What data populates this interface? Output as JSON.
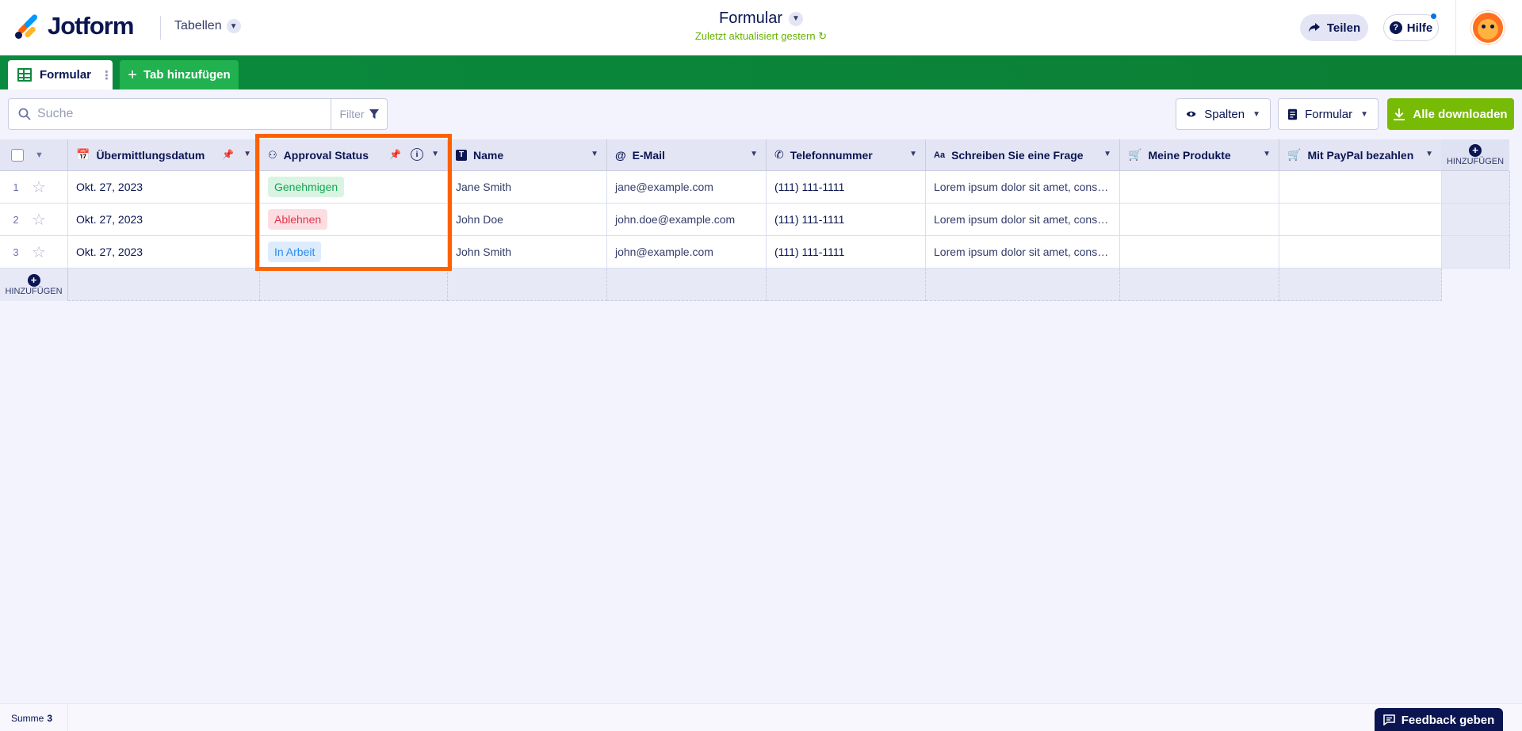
{
  "header": {
    "logo_text": "Jotform",
    "tables_menu": "Tabellen",
    "title": "Formular",
    "subtitle": "Zuletzt aktualisiert gestern",
    "share_label": "Teilen",
    "help_label": "Hilfe"
  },
  "tabs": {
    "active_label": "Formular",
    "add_label": "Tab hinzufügen"
  },
  "toolbar": {
    "search_placeholder": "Suche",
    "filter_label": "Filter",
    "columns_label": "Spalten",
    "form_label": "Formular",
    "download_label": "Alle downloaden"
  },
  "columns": [
    {
      "label": "Übermittlungsdatum",
      "icon": "calendar-icon"
    },
    {
      "label": "Approval Status",
      "icon": "hierarchy-icon"
    },
    {
      "label": "Name",
      "icon": "text-icon"
    },
    {
      "label": "E-Mail",
      "icon": "at-icon"
    },
    {
      "label": "Telefonnummer",
      "icon": "phone-icon"
    },
    {
      "label": "Schreiben Sie eine Frage",
      "icon": "text-size-icon"
    },
    {
      "label": "Meine Produkte",
      "icon": "cart-icon"
    },
    {
      "label": "Mit PayPal bezahlen",
      "icon": "cart-icon"
    }
  ],
  "add_column_label": "HINZUFÜGEN",
  "add_row_label": "HINZUFÜGEN",
  "rows": [
    {
      "num": "1",
      "date": "Okt. 27, 2023",
      "status": "Genehmigen",
      "status_color": "#15a552",
      "status_bg": "#d9f4e3",
      "name": "Jane Smith",
      "email": "jane@example.com",
      "phone": "(111) 111-1111",
      "question": "Lorem ipsum dolor sit amet, cons…",
      "products": "",
      "paypal": ""
    },
    {
      "num": "2",
      "date": "Okt. 27, 2023",
      "status": "Ablehnen",
      "status_color": "#e0364c",
      "status_bg": "#fcdde2",
      "name": "John Doe",
      "email": "john.doe@example.com",
      "phone": "(111) 111-1111",
      "question": "Lorem ipsum dolor sit amet, cons…",
      "products": "",
      "paypal": ""
    },
    {
      "num": "3",
      "date": "Okt. 27, 2023",
      "status": "In Arbeit",
      "status_color": "#2f8ae8",
      "status_bg": "#dcecfc",
      "name": "John Smith",
      "email": "john@example.com",
      "phone": "(111) 111-1111",
      "question": "Lorem ipsum dolor sit amet, cons…",
      "products": "",
      "paypal": ""
    }
  ],
  "footer": {
    "sum_label": "Summe",
    "sum_value": "3",
    "feedback_label": "Feedback geben"
  },
  "colors": {
    "brand_green": "#0a8a3e",
    "download_green": "#78bb07",
    "highlight_orange": "#ff6100",
    "navy": "#0a1551"
  }
}
